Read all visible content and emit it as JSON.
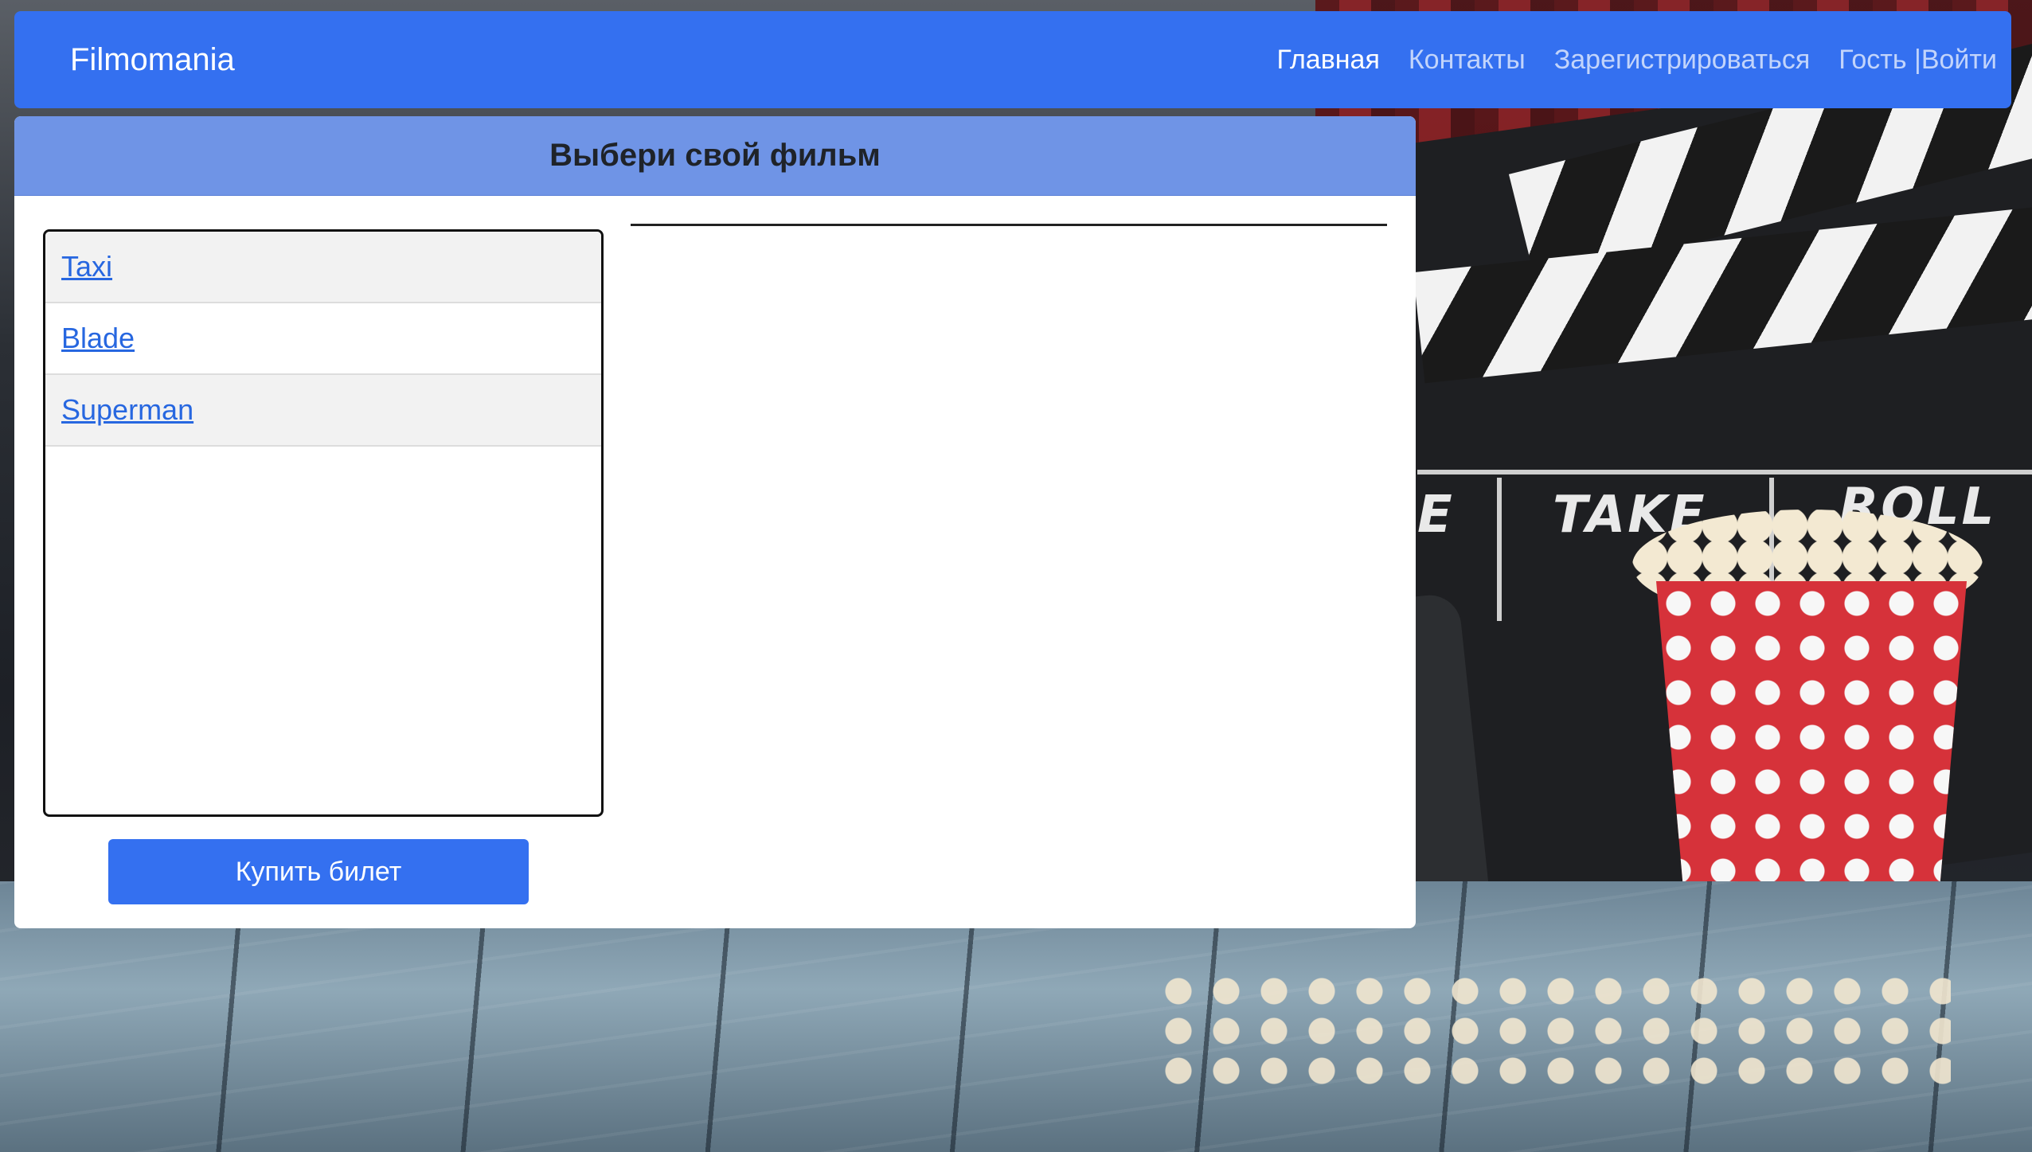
{
  "navbar": {
    "brand": "Filmomania",
    "links": [
      {
        "label": "Главная",
        "active": true
      },
      {
        "label": "Контакты",
        "active": false
      },
      {
        "label": "Зарегистрироваться",
        "active": false
      },
      {
        "label": "Гость |Войти",
        "active": false
      }
    ]
  },
  "card": {
    "title": "Выбери свой фильм",
    "movies": [
      {
        "label": "Taxi"
      },
      {
        "label": "Blade"
      },
      {
        "label": "Superman"
      }
    ],
    "buy_label": "Купить билет"
  },
  "background": {
    "clapper_words": [
      "E",
      "TAKE",
      "ROLL"
    ]
  },
  "colors": {
    "primary": "#3470f0",
    "card_header": "#6f94e6",
    "link": "#2767e0"
  }
}
